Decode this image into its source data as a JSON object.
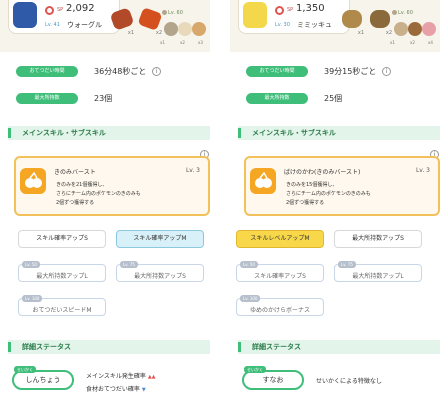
{
  "panels": [
    {
      "pokemon": {
        "sp_label": "SP",
        "sp": "2,092",
        "level": "Lv. 41",
        "name": "ウォーグル"
      },
      "berries": [
        {
          "count": "x1"
        },
        {
          "count": "x2"
        }
      ],
      "ingredient_level": "Lv. 60",
      "ingredients": [
        {
          "count": "x1"
        },
        {
          "count": "x2"
        },
        {
          "count": "x3"
        }
      ],
      "help_time": {
        "label": "おてつだい時間",
        "value": "36分48秒ごと"
      },
      "max_carry": {
        "label": "最大所持数",
        "value": "23個"
      },
      "skill_section_title": "メインスキル・サブスキル",
      "main_skill": {
        "name": "きのみバースト",
        "level": "Lv. 3",
        "desc_1": "きのみを21個獲得し、",
        "desc_2": "さらにチーム内のポケモンのきのみも",
        "desc_3": "2個ずつ獲得する"
      },
      "subskills": [
        {
          "label": "スキル確率アップS"
        },
        {
          "label": "スキル確率アップM"
        }
      ],
      "locked_skills": [
        {
          "tag": "Lv. 50",
          "label": "最大所持数アップL"
        },
        {
          "tag": "Lv. 75",
          "label": "最大所持数アップS"
        },
        {
          "tag": "Lv. 100",
          "label": "おてつだいスピードM"
        }
      ],
      "detail_title": "詳細ステータス",
      "nature_tag": "せいかく",
      "nature": "しんちょう",
      "effects": [
        "メインスキル発生確率",
        "食材おてつだい確率"
      ]
    },
    {
      "pokemon": {
        "sp_label": "SP",
        "sp": "1,350",
        "level": "Lv. 30",
        "name": "ミミッキュ"
      },
      "berries": [
        {
          "count": "x1"
        },
        {
          "count": "x2"
        }
      ],
      "ingredient_level": "Lv. 60",
      "ingredients": [
        {
          "count": "x1"
        },
        {
          "count": "x2"
        },
        {
          "count": "x4"
        }
      ],
      "help_time": {
        "label": "おてつだい時間",
        "value": "39分15秒ごと"
      },
      "max_carry": {
        "label": "最大所持数",
        "value": "25個"
      },
      "skill_section_title": "メインスキル・サブスキル",
      "main_skill": {
        "name": "ばけのかわ(きのみバースト)",
        "level": "Lv. 3",
        "desc_1": "きのみを15個獲得し、",
        "desc_2": "さらにチーム内のポケモンのきのみも",
        "desc_3": "2個ずつ獲得する"
      },
      "subskills": [
        {
          "label": "スキルレベルアップM"
        },
        {
          "label": "最大所持数アップS"
        }
      ],
      "locked_skills": [
        {
          "tag": "Lv. 50",
          "label": "スキル確率アップS"
        },
        {
          "tag": "Lv. 75",
          "label": "最大所持数アップL"
        },
        {
          "tag": "Lv. 100",
          "label": "ゆめのかけらボーナス"
        }
      ],
      "detail_title": "詳細ステータス",
      "nature_tag": "せいかく",
      "nature": "すなお",
      "effects": [
        "せいかくによる特徴なし"
      ]
    }
  ],
  "colors": {
    "accent": "#3fbe7a",
    "skill_border": "#f2c15a",
    "gold_button": "#f8d84a"
  },
  "icons": {
    "sp": "sp-icon",
    "info": "info-icon",
    "skill": "berry-burst-icon"
  }
}
